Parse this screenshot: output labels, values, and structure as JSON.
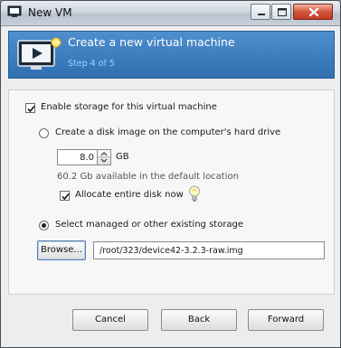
{
  "window": {
    "title": "New VM"
  },
  "banner": {
    "heading": "Create a new virtual machine",
    "step": "Step 4 of 5"
  },
  "storage": {
    "enable_label": "Enable storage for this virtual machine",
    "enable_checked": true,
    "create_disk_label": "Create a disk image on the computer's hard drive",
    "create_disk_selected": false,
    "disk_size_value": "8.0",
    "disk_size_unit": "GB",
    "available_text": "60.2 Gb available in the default location",
    "allocate_label": "Allocate entire disk now",
    "allocate_checked": true,
    "existing_label": "Select managed or other existing storage",
    "existing_selected": true,
    "browse_label": "Browse...",
    "path_value": "/root/323/device42-3.2.3-raw.img"
  },
  "footer": {
    "cancel_label": "Cancel",
    "back_label": "Back",
    "forward_label": "Forward"
  },
  "colors": {
    "banner": "#3d7fc0",
    "banner_step": "#9fd0ff",
    "close_button": "#d4553b"
  },
  "icons": {
    "app": "vm-app-icon",
    "banner": "monitor-play-icon",
    "hint": "lightbulb-icon"
  }
}
